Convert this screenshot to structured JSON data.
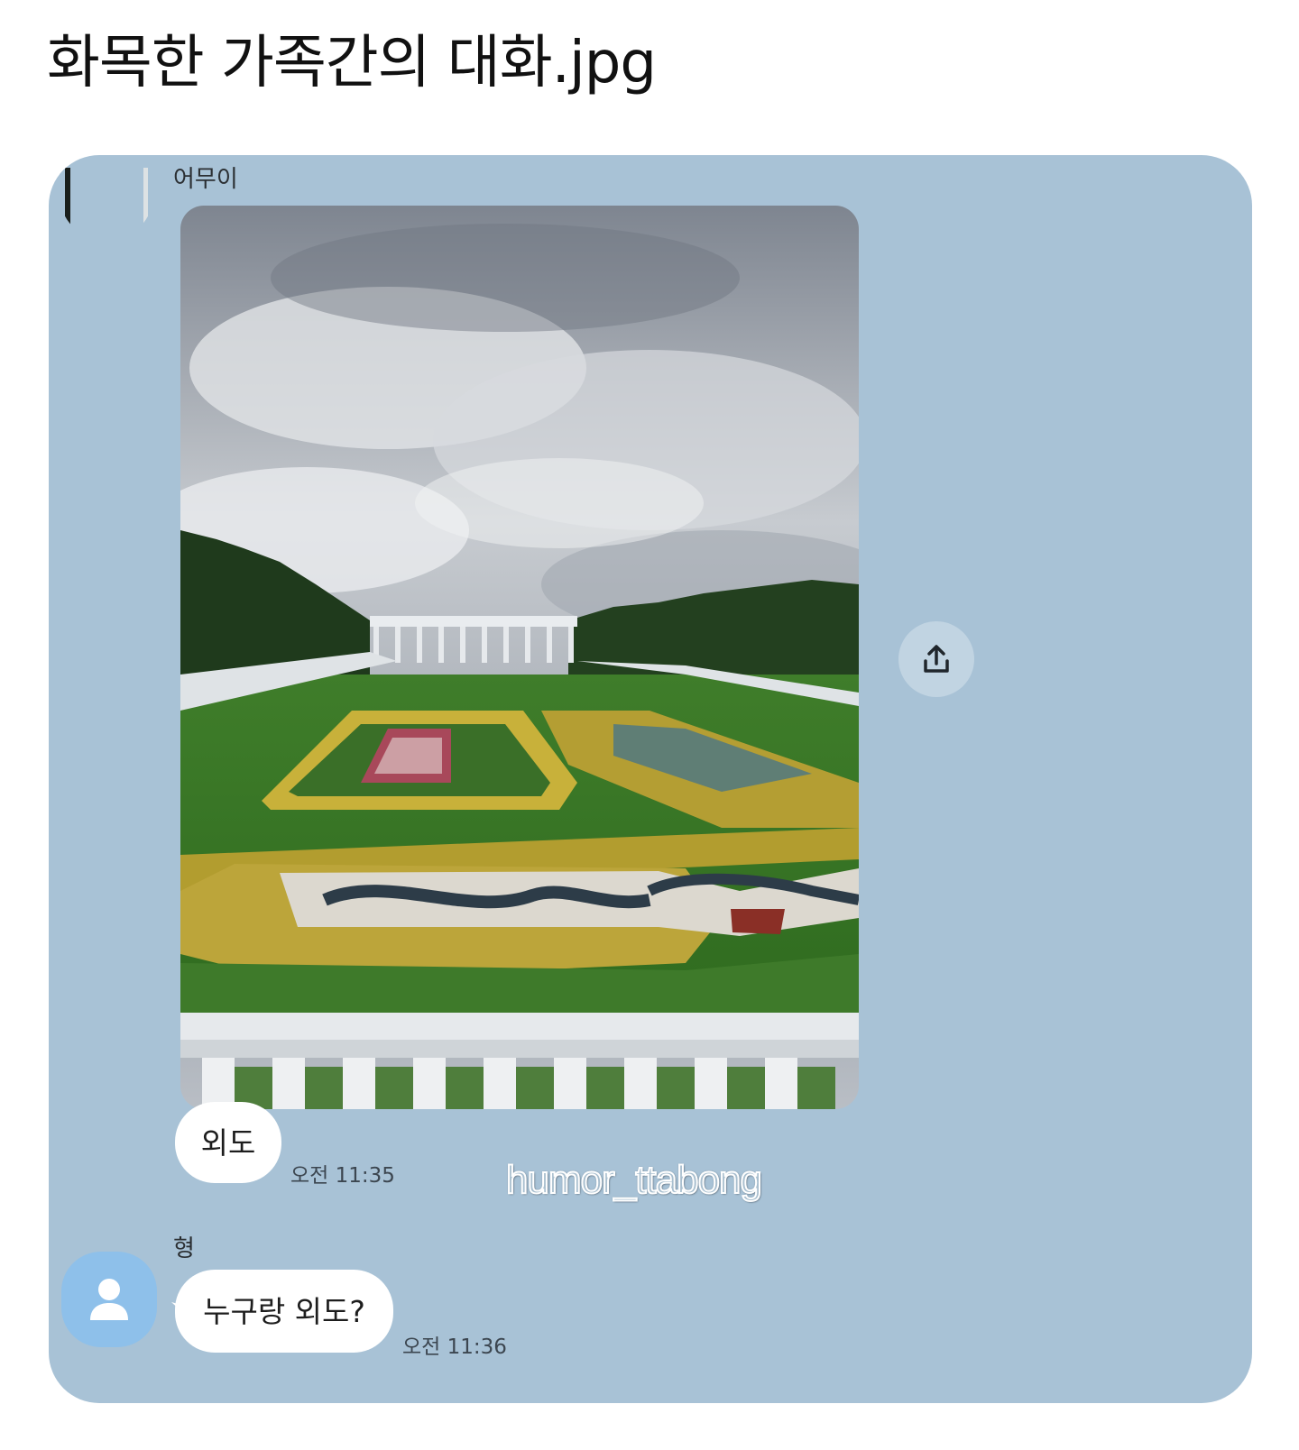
{
  "page": {
    "title": "화목한 가족간의 대화.jpg"
  },
  "chat": {
    "background_color": "#a8c2d6",
    "messages": [
      {
        "sender": "어무이",
        "attachment": "garden-photo",
        "text": "외도",
        "time": "오전 11:35"
      },
      {
        "sender": "형",
        "avatar": "default-person-icon",
        "text": "누구랑 외도?",
        "time": "오전 11:36"
      }
    ],
    "share_icon": "upload-share-icon"
  },
  "watermark": "humor_ttabong"
}
